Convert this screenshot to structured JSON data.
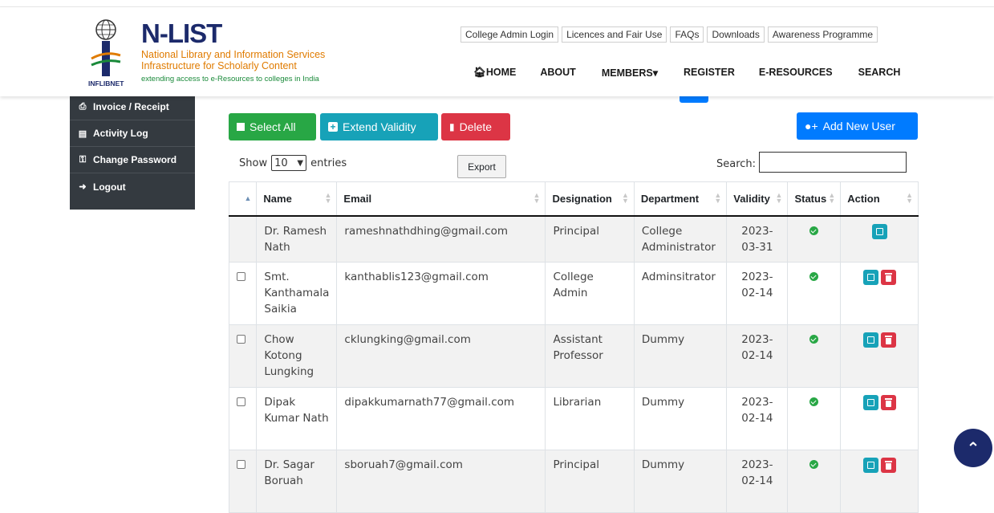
{
  "brand": {
    "name": "N-LIST",
    "line1": "National Library and Information Services",
    "line2": "Infrastructure for Scholarly Content",
    "tagline": "extending access to e-Resources to colleges in India",
    "org": "INFLIBNET"
  },
  "top_links": [
    "College Admin Login",
    "Licences and Fair Use",
    "FAQs",
    "Downloads",
    "Awareness Programme"
  ],
  "main_nav": {
    "home": "HOME",
    "about": "ABOUT",
    "members": "MEMBERS",
    "register": "REGISTER",
    "eresources": "E-RESOURCES",
    "search": "SEARCH"
  },
  "sidebar": {
    "items": [
      {
        "label": "Invoice / Receipt",
        "icon": "printer-icon"
      },
      {
        "label": "Activity Log",
        "icon": "list-icon"
      },
      {
        "label": "Change Password",
        "icon": "key-icon"
      },
      {
        "label": "Logout",
        "icon": "sign-out-icon"
      }
    ]
  },
  "actions": {
    "select_all": "Select All",
    "extend_validity": "Extend Validity",
    "delete": "Delete",
    "add_new_user": "Add New User",
    "export": "Export"
  },
  "table_controls": {
    "show_label": "Show",
    "entries_value": "10",
    "entries_label": "entries",
    "search_label": "Search:"
  },
  "table": {
    "headers": [
      "Name",
      "Email",
      "Designation",
      "Department",
      "Validity",
      "Status",
      "Action"
    ],
    "rows": [
      {
        "name": "Dr. Ramesh Nath",
        "email": "rameshnathdhing@gmail.com",
        "designation": "Principal",
        "department": "College Administrator",
        "validity": "2023-03-31",
        "checkbox": false,
        "delete": false
      },
      {
        "name": "Smt. Kanthamala Saikia",
        "email": "kanthablis123@gmail.com",
        "designation": "College Admin",
        "department": "Adminsitrator",
        "validity": "2023-02-14",
        "checkbox": true,
        "delete": true
      },
      {
        "name": "Chow Kotong Lungking",
        "email": "cklungking@gmail.com",
        "designation": "Assistant Professor",
        "department": "Dummy",
        "validity": "2023-02-14",
        "checkbox": true,
        "delete": true
      },
      {
        "name": "Dipak Kumar Nath",
        "email": "dipakkumarnath77@gmail.com",
        "designation": "Librarian",
        "department": "Dummy",
        "validity": "2023-02-14",
        "checkbox": true,
        "delete": true
      },
      {
        "name": "Dr. Sagar Boruah",
        "email": "sboruah7@gmail.com",
        "designation": "Principal",
        "department": "Dummy",
        "validity": "2023-02-14",
        "checkbox": true,
        "delete": true
      }
    ]
  },
  "colors": {
    "navy": "#1c2a6b",
    "sidebar": "#343a40",
    "green": "#28a745",
    "teal": "#17a2b8",
    "red": "#dc3545",
    "blue": "#007bff"
  }
}
